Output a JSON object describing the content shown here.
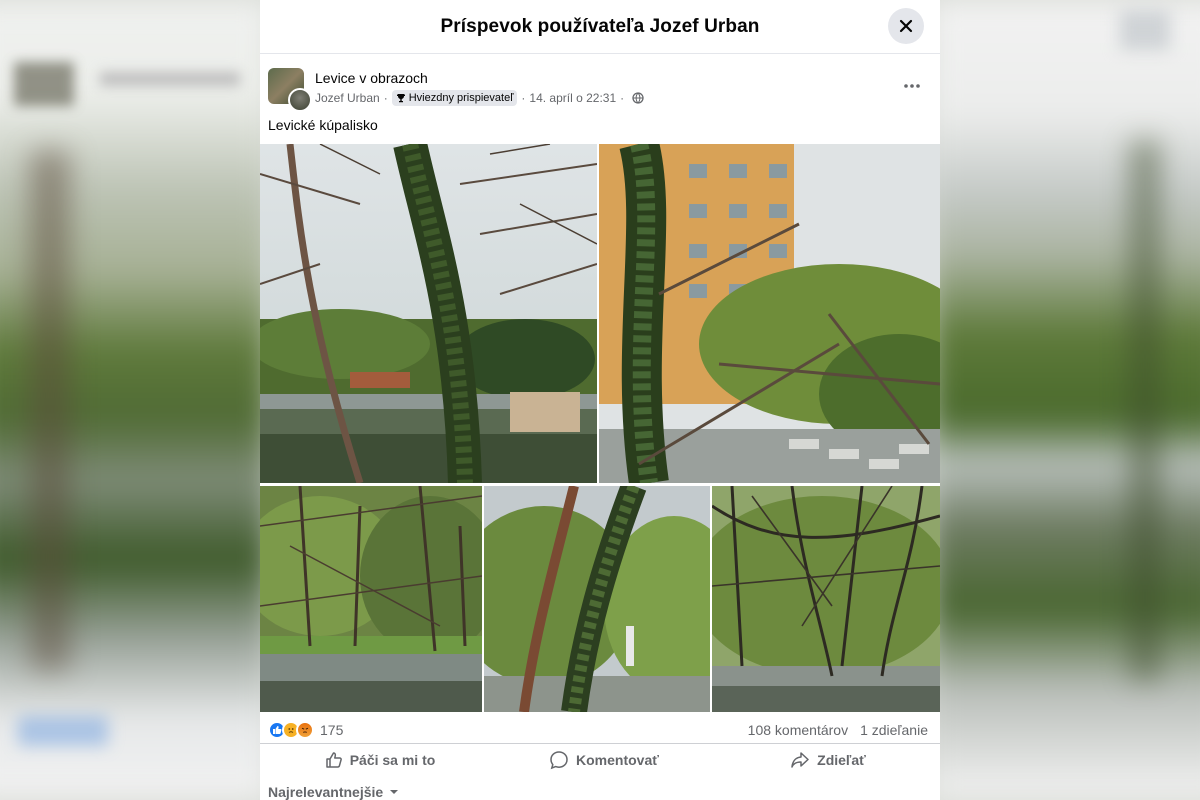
{
  "modal": {
    "title": "Príspevok používateľa Jozef Urban"
  },
  "post": {
    "group_name": "Levice v obrazoch",
    "author": "Jozef Urban",
    "badge": "Hviezdny prispievateľ",
    "timestamp": "14. apríl o 22:31",
    "text": "Levické kúpalisko"
  },
  "stats": {
    "reaction_count": "175",
    "comments": "108 komentárov",
    "shares": "1 zdieľanie"
  },
  "actions": {
    "like": "Páči sa mi to",
    "comment": "Komentovať",
    "share": "Zdieľať"
  },
  "comments_sort": "Najrelevantnejšie",
  "colors": {
    "like_blue": "#1877f2",
    "text_primary": "#050505",
    "text_secondary": "#65676b"
  }
}
